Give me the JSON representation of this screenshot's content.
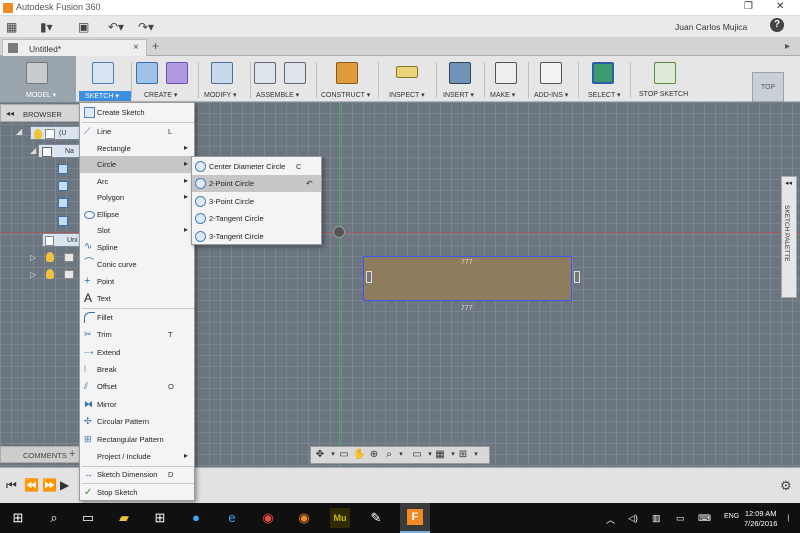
{
  "window": {
    "title": "Autodesk Fusion 360",
    "user": "Juan Carlos Mujica",
    "help": "?"
  },
  "document": {
    "tab_name": "Untitled*",
    "close": "×",
    "new_tab": "+"
  },
  "ribbon": {
    "model": "MODEL ▾",
    "sketch": "SKETCH ▾",
    "create": "CREATE ▾",
    "modify": "MODIFY ▾",
    "assemble": "ASSEMBLE ▾",
    "construct": "CONSTRUCT ▾",
    "inspect": "INSPECT ▾",
    "insert": "INSERT ▾",
    "make": "MAKE ▾",
    "addins": "ADD-INS ▾",
    "select": "SELECT ▾",
    "stop_sketch": "STOP SKETCH",
    "view_cube": "TOP"
  },
  "browser": {
    "title": "BROWSER",
    "collapse": "◂◂",
    "root": "(U",
    "named": "Na",
    "unit": "Uni"
  },
  "comments": {
    "title": "COMMENTS",
    "add": "+"
  },
  "palette": {
    "title": "SKETCH PALETTE",
    "collapse": "◂◂"
  },
  "canvas": {
    "dim_top": "777",
    "dim_bottom": "777"
  },
  "sketch_menu": {
    "create_sketch": "Create Sketch",
    "line": "Line",
    "line_sc": "L",
    "rectangle": "Rectangle",
    "circle": "Circle",
    "arc": "Arc",
    "polygon": "Polygon",
    "ellipse": "Ellipse",
    "slot": "Slot",
    "spline": "Spline",
    "conic": "Conic curve",
    "point": "Point",
    "text": "Text",
    "fillet": "Fillet",
    "trim": "Trim",
    "trim_sc": "T",
    "extend": "Extend",
    "break": "Break",
    "offset": "Offset",
    "offset_sc": "O",
    "mirror": "Mirror",
    "circular_pattern": "Circular Pattern",
    "rect_pattern": "Rectangular Pattern",
    "project_include": "Project / Include",
    "sketch_dimension": "Sketch Dimension",
    "sketch_dimension_sc": "D",
    "stop_sketch": "Stop Sketch"
  },
  "circle_menu": {
    "center_diameter": "Center Diameter Circle",
    "center_diameter_sc": "C",
    "two_point": "2-Point Circle",
    "three_point": "3-Point Circle",
    "two_tangent": "2-Tangent Circle",
    "three_tangent": "3-Tangent Circle"
  },
  "taskbar": {
    "time": "12:09 AM",
    "date": "7/26/2016",
    "lang": "ENG"
  }
}
